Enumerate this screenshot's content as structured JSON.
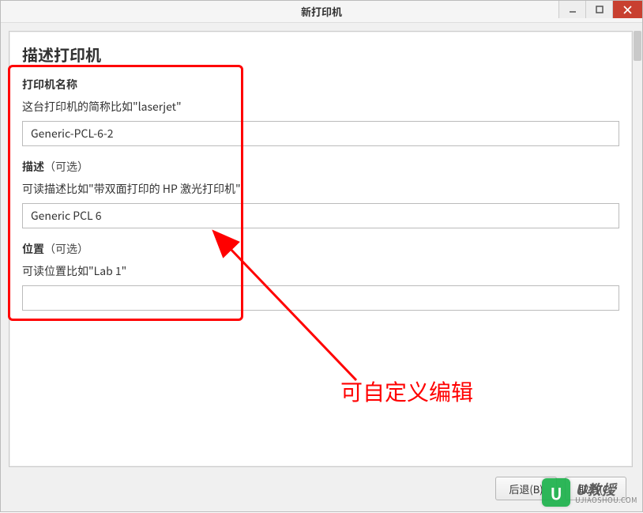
{
  "window": {
    "title": "新打印机"
  },
  "page": {
    "heading": "描述打印机"
  },
  "fields": {
    "name": {
      "label_bold": "打印机名称",
      "hint": "这台打印机的简称比如\"laserjet\"",
      "value": "Generic-PCL-6-2"
    },
    "description": {
      "label_bold": "描述",
      "label_optional": "（可选）",
      "hint": "可读描述比如\"带双面打印的 HP 激光打印机\"",
      "value": "Generic PCL 6"
    },
    "location": {
      "label_bold": "位置",
      "label_optional": "（可选）",
      "hint": "可读位置比如\"Lab 1\"",
      "value": ""
    }
  },
  "buttons": {
    "back": "后退(B)",
    "cancel": "取消(C)"
  },
  "annotation": {
    "text": "可自定义编辑"
  },
  "watermark": {
    "brand": "U教授",
    "url": "UJIAOSHOU.COM",
    "badge": "U"
  }
}
